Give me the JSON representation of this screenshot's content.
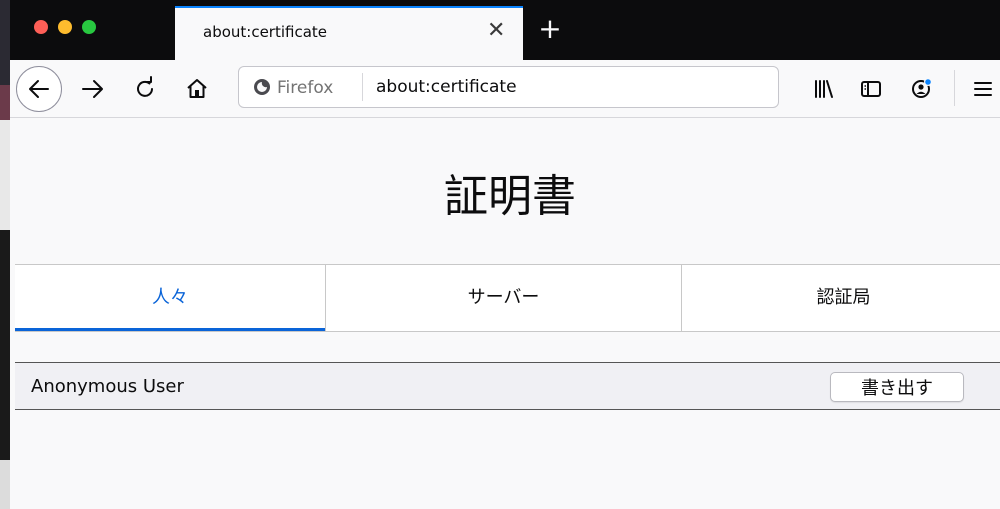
{
  "browser": {
    "tab": {
      "title": "about:certificate",
      "close_glyph": "✕"
    },
    "new_tab_glyph": "+",
    "urlbar": {
      "identity_label": "Firefox",
      "url": "about:certificate"
    },
    "icons": [
      "back-arrow-icon",
      "forward-arrow-icon",
      "reload-icon",
      "home-icon",
      "firefox-logo-icon",
      "library-icon",
      "sidebar-icon",
      "account-icon",
      "hamburger-menu-icon"
    ],
    "accent_color": "#0a84ff"
  },
  "page": {
    "title": "証明書",
    "tabs": [
      {
        "label": "人々",
        "selected": true
      },
      {
        "label": "サーバー",
        "selected": false
      },
      {
        "label": "認証局",
        "selected": false
      }
    ],
    "certificates": [
      {
        "name": "Anonymous User",
        "action_label": "書き出す"
      }
    ],
    "selected_tab_color": "#0a64d8"
  }
}
